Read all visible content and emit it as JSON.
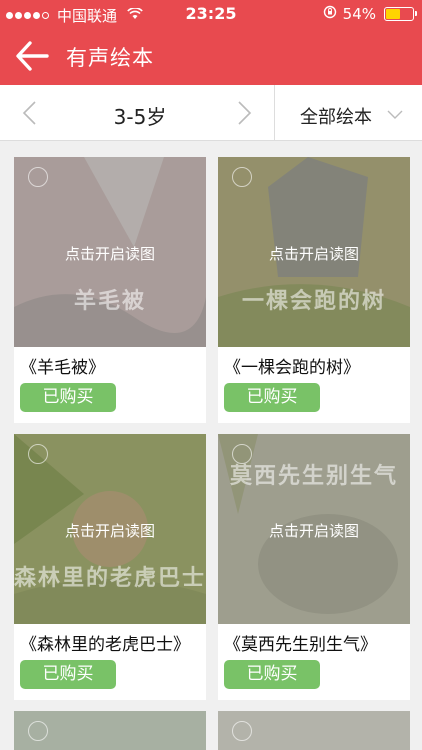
{
  "status_bar": {
    "carrier": "中国联通",
    "time": "23:25",
    "battery": "54%",
    "battery_level": 0.54,
    "signal_bars": 4
  },
  "nav": {
    "title": "有声绘本",
    "back_icon": "arrow-left-icon"
  },
  "filter": {
    "age": "3-5岁",
    "category": "全部绘本"
  },
  "books": [
    {
      "title": "《羊毛被》",
      "overlay": "点击开启读图",
      "cover_text": "羊毛被",
      "status": "已购买",
      "cover_color": "#c9b6b2"
    },
    {
      "title": "《一棵会跑的树》",
      "overlay": "点击开启读图",
      "cover_text": "一棵会跑的树",
      "status": "已购买",
      "cover_color": "#a9a46a"
    },
    {
      "title": "《森林里的老虎巴士》",
      "overlay": "点击开启读图",
      "cover_text": "森林里的老虎巴士",
      "status": "已购买",
      "cover_color": "#9aa65a"
    },
    {
      "title": "《莫西先生别生气》",
      "overlay": "点击开启读图",
      "cover_text": "莫西先生别生气",
      "status": "已购买",
      "cover_color": "#b8b9a0"
    }
  ],
  "colors": {
    "header": "#e84a4f",
    "button": "#79c267"
  }
}
